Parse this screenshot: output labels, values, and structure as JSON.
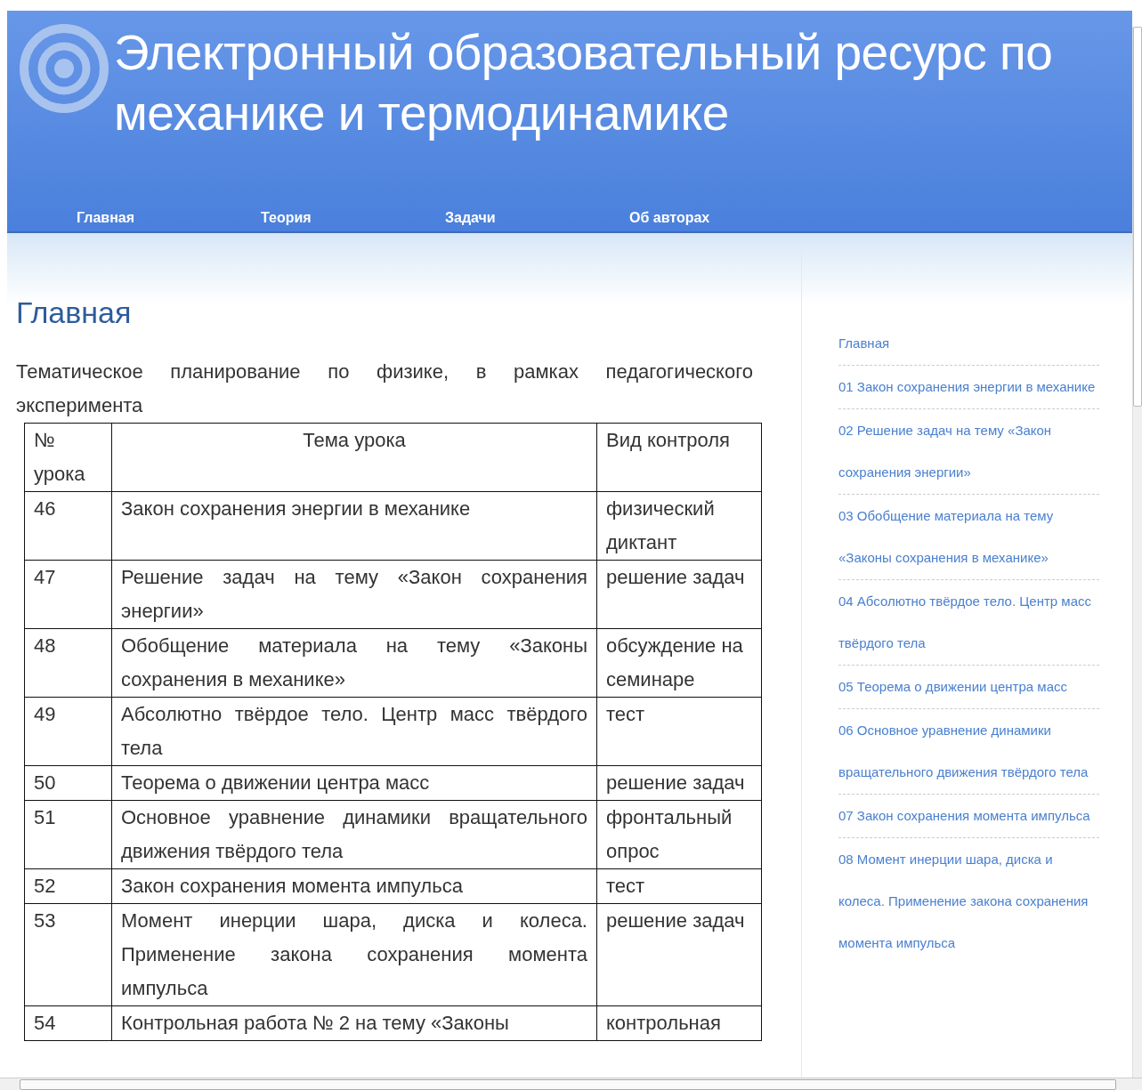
{
  "header": {
    "title_lines": [
      "Электронный образовательный ресурс по",
      "механике и термодинамике"
    ]
  },
  "nav": [
    {
      "label": "Главная"
    },
    {
      "label": "Теория"
    },
    {
      "label": "Задачи"
    },
    {
      "label": "Об авторах"
    }
  ],
  "main": {
    "heading": "Главная",
    "intro": "Тематическое планирование по физике, в рамках педагогического эксперимента",
    "table": {
      "columns": [
        "№ урока",
        "Тема урока",
        "Вид контроля"
      ],
      "rows": [
        {
          "number": "46",
          "topic": "Закон сохранения энергии в механике",
          "control": "физический диктант"
        },
        {
          "number": "47",
          "topic": "Решение задач на тему «Закон сохранения энергии»",
          "control": "решение задач"
        },
        {
          "number": "48",
          "topic": "Обобщение материала на тему «Законы сохранения в механике»",
          "control": "обсуждение на семинаре"
        },
        {
          "number": "49",
          "topic": "Абсолютно твёрдое тело. Центр масс твёрдого тела",
          "control": "тест"
        },
        {
          "number": "50",
          "topic": "Теорема о движении центра масс",
          "control": "решение задач"
        },
        {
          "number": "51",
          "topic": "Основное уравнение динамики вращательного движения твёрдого тела",
          "control": "фронтальный опрос"
        },
        {
          "number": "52",
          "topic": "Закон сохранения момента импульса",
          "control": "тест"
        },
        {
          "number": "53",
          "topic": "Момент инерции шара, диска и колеса. Применение закона сохранения момента импульса",
          "control": "решение задач"
        },
        {
          "number": "54",
          "topic": "Контрольная работа № 2 на тему «Законы",
          "control": "контрольная"
        }
      ]
    }
  },
  "sidebar": {
    "links": [
      "Главная",
      "01 Закон сохранения энергии в механике",
      "02 Решение задач на тему «Закон сохранения энергии»",
      "03 Обобщение материала на тему «Законы сохранения в механике»",
      "04 Абсолютно твёрдое тело. Центр масс твёрдого тела",
      "05 Теорема о движении центра масс",
      "06 Основное уравнение динамики вращательного движения твёрдого тела",
      "07 Закон сохранения момента импульса",
      "08 Момент инерции шара, диска и колеса. Применение закона сохранения момента импульса"
    ]
  }
}
